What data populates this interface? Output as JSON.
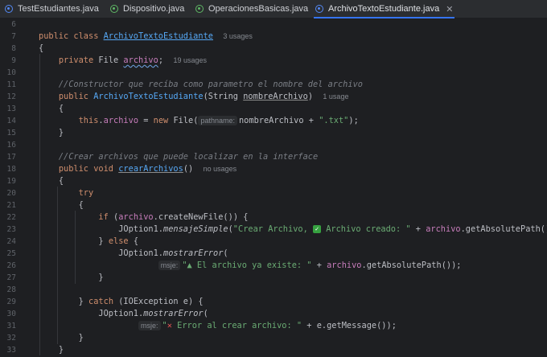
{
  "tabs": [
    {
      "label": "TestEstudiantes.java",
      "icon": "java-class-icon",
      "active": false
    },
    {
      "label": "Dispositivo.java",
      "icon": "java-class-icon",
      "active": false
    },
    {
      "label": "OperacionesBasicas.java",
      "icon": "java-class-icon",
      "active": false
    },
    {
      "label": "ArchivoTextoEstudiante.java",
      "icon": "java-class-icon",
      "active": true
    }
  ],
  "close_glyph": "✕",
  "line_numbers": [
    "6",
    "7",
    "8",
    "9",
    "10",
    "11",
    "12",
    "13",
    "14",
    "15",
    "16",
    "17",
    "18",
    "19",
    "20",
    "21",
    "22",
    "23",
    "24",
    "25",
    "26",
    "27",
    "28",
    "29",
    "30",
    "31",
    "32",
    "33"
  ],
  "code": {
    "l7": {
      "kw1": "public class ",
      "cls": "ArchivoTextoEstudiante",
      "hint": "3 usages"
    },
    "l8": {
      "t": "{"
    },
    "l9": {
      "kw": "private ",
      "t1": "File ",
      "fld": "archivo",
      "t2": ";",
      "hint": "19 usages"
    },
    "l11": {
      "cmt": "//Constructor que recíba como parametro el nombre del archivo"
    },
    "l12": {
      "kw": "public ",
      "mtd": "ArchivoTextoEstudiante",
      "t1": "(String ",
      "param": "nombreArchivo",
      "t2": ")",
      "hint": "1 usage"
    },
    "l13": {
      "t": "{"
    },
    "l14": {
      "kw1": "this",
      "t1": ".",
      "fld": "archivo",
      "t2": " = ",
      "kw2": "new ",
      "t3": "File(",
      "inlay": "pathname:",
      "t4": "nombreArchivo + ",
      "str": "\".txt\"",
      "t5": ");"
    },
    "l15": {
      "t": "}"
    },
    "l17": {
      "cmt": "//Crear archivos que puede localizar en la interface"
    },
    "l18": {
      "kw": "public void ",
      "mtd": "crearArchivos",
      "t1": "()",
      "hint": "no usages"
    },
    "l19": {
      "t": "{"
    },
    "l20": {
      "kw": "try"
    },
    "l21": {
      "t": "{"
    },
    "l22": {
      "kw": "if ",
      "t1": "(",
      "fld": "archivo",
      "t2": ".createNewFile()) {"
    },
    "l23": {
      "t1": "JOption1.",
      "it": "mensajeSimple",
      "t2": "(",
      "str1": "\"Crear Archivo, ",
      "str2": " Archivo creado: \"",
      "t3": " + ",
      "fld": "archivo",
      "t4": ".getAbsolutePath());"
    },
    "l24": {
      "t1": "} ",
      "kw": "else",
      "t2": " {"
    },
    "l25": {
      "t1": "JOption1.",
      "it": "mostrarError",
      "t2": "("
    },
    "l26": {
      "inlay": "msje:",
      "str": "\"▲ El archivo ya existe: \"",
      "t1": " + ",
      "fld": "archivo",
      "t2": ".getAbsolutePath());"
    },
    "l27": {
      "t": "}"
    },
    "l29": {
      "t1": "} ",
      "kw": "catch",
      "t2": " (IOException e) {"
    },
    "l30": {
      "t1": "JOption1.",
      "it": "mostrarError",
      "t2": "("
    },
    "l31": {
      "inlay": "msje:",
      "str1": "\"",
      "str2": " Error al crear archivo: \"",
      "t1": " + e.getMessage());"
    },
    "l32": {
      "t": "}"
    },
    "l33": {
      "t": "}"
    }
  }
}
